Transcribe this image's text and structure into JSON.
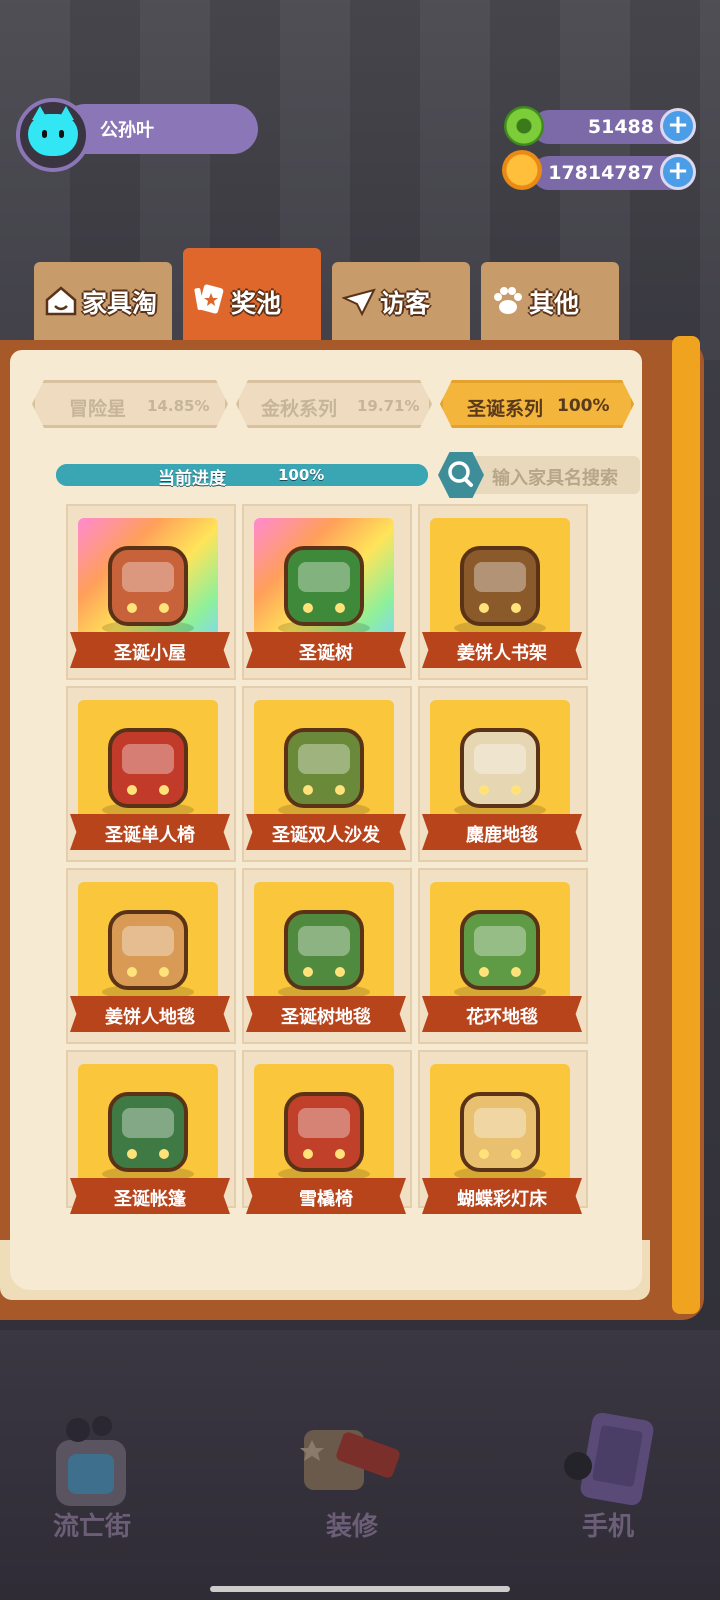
{
  "player": {
    "name": "公孙叶"
  },
  "currency": {
    "green": {
      "value": "51488"
    },
    "gold": {
      "value": "17814787"
    }
  },
  "tabs": [
    {
      "label": "家具淘",
      "icon": "house-icon"
    },
    {
      "label": "奖池",
      "icon": "card-star-icon",
      "active": true
    },
    {
      "label": "访客",
      "icon": "paper-plane-icon"
    },
    {
      "label": "其他",
      "icon": "paw-icon"
    }
  ],
  "series": [
    {
      "label": "冒险星",
      "pct": "14.85%"
    },
    {
      "label": "金秋系列",
      "pct": "19.71%"
    },
    {
      "label": "圣诞系列",
      "pct": "100%",
      "active": true
    }
  ],
  "progress": {
    "label": "当前进度",
    "value": "100%",
    "fraction": 1.0
  },
  "search": {
    "placeholder": "输入家具名搜索"
  },
  "items": [
    {
      "name": "圣诞小屋",
      "rare": true,
      "icon": "gingerbread-house-icon"
    },
    {
      "name": "圣诞树",
      "rare": true,
      "icon": "christmas-tree-icon"
    },
    {
      "name": "姜饼人书架",
      "rare": false,
      "icon": "bookshelf-icon"
    },
    {
      "name": "圣诞单人椅",
      "rare": false,
      "icon": "armchair-icon"
    },
    {
      "name": "圣诞双人沙发",
      "rare": false,
      "icon": "sofa-icon"
    },
    {
      "name": "麋鹿地毯",
      "rare": false,
      "icon": "reindeer-rug-icon"
    },
    {
      "name": "姜饼人地毯",
      "rare": false,
      "icon": "gingerbread-rug-icon"
    },
    {
      "name": "圣诞树地毯",
      "rare": false,
      "icon": "tree-rug-icon"
    },
    {
      "name": "花环地毯",
      "rare": false,
      "icon": "wreath-rug-icon"
    },
    {
      "name": "圣诞帐篷",
      "rare": false,
      "icon": "tent-icon"
    },
    {
      "name": "雪橇椅",
      "rare": false,
      "icon": "sled-chair-icon"
    },
    {
      "name": "蝴蝶彩灯床",
      "rare": false,
      "icon": "light-bed-icon"
    }
  ],
  "nav": [
    {
      "label": "流亡街",
      "icon": "street-icon"
    },
    {
      "label": "装修",
      "icon": "decorate-icon"
    },
    {
      "label": "手机",
      "icon": "phone-icon"
    }
  ]
}
